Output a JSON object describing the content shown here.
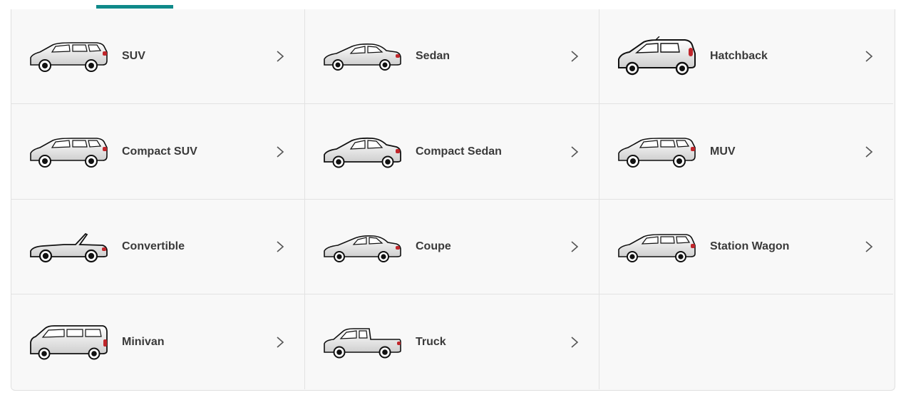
{
  "categories": [
    {
      "label": "SUV",
      "icon": "suv-icon"
    },
    {
      "label": "Sedan",
      "icon": "sedan-icon"
    },
    {
      "label": "Hatchback",
      "icon": "hatchback-icon"
    },
    {
      "label": "Compact SUV",
      "icon": "compact-suv-icon"
    },
    {
      "label": "Compact Sedan",
      "icon": "compact-sedan-icon"
    },
    {
      "label": "MUV",
      "icon": "muv-icon"
    },
    {
      "label": "Convertible",
      "icon": "convertible-icon"
    },
    {
      "label": "Coupe",
      "icon": "coupe-icon"
    },
    {
      "label": "Station Wagon",
      "icon": "station-wagon-icon"
    },
    {
      "label": "Minivan",
      "icon": "minivan-icon"
    },
    {
      "label": "Truck",
      "icon": "truck-icon"
    }
  ],
  "colors": {
    "accent": "#0f8a8a",
    "tail_light": "#c0262b"
  }
}
